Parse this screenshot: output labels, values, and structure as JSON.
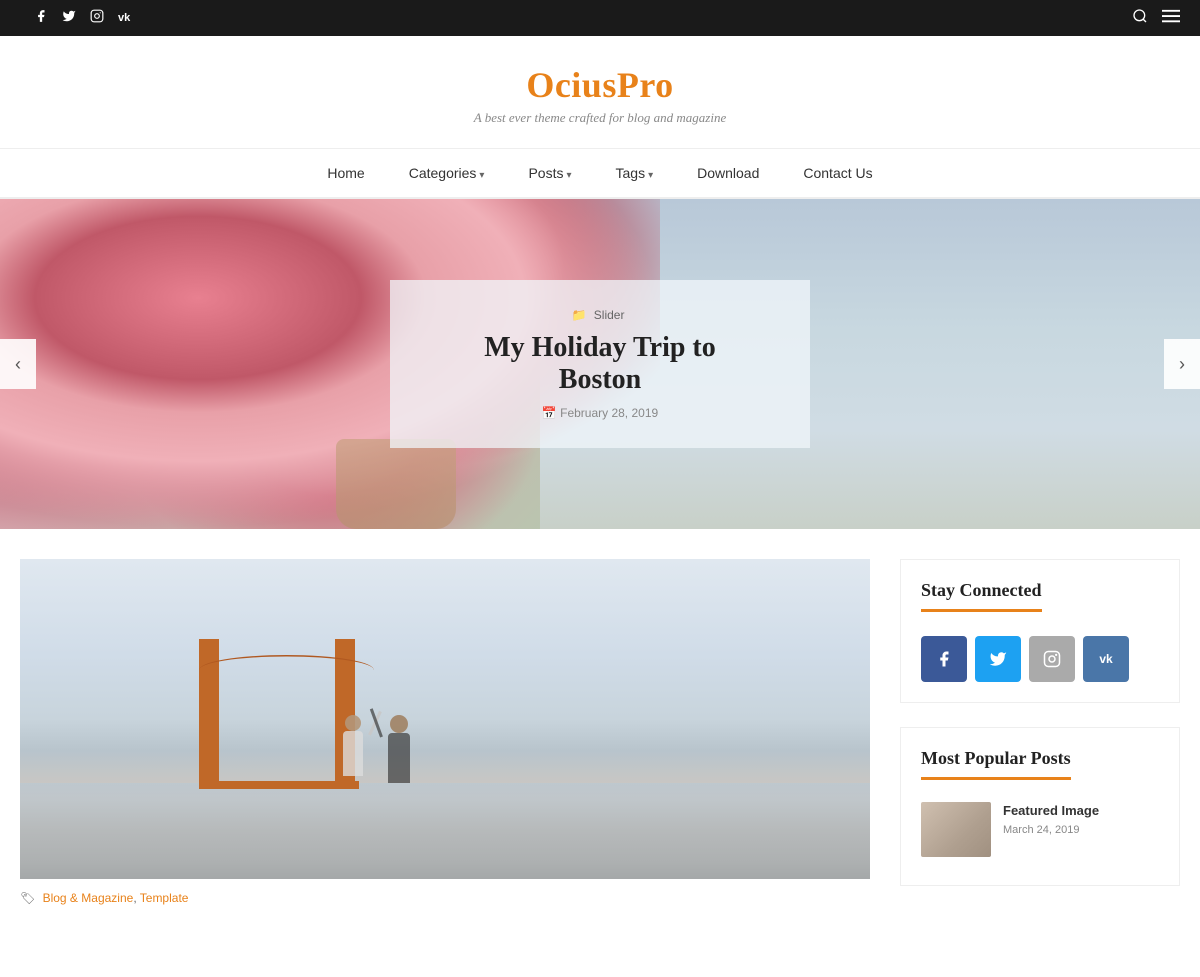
{
  "topbar": {
    "social_icons": [
      "f",
      "t",
      "i",
      "v"
    ],
    "social_names": [
      "facebook",
      "twitter",
      "instagram",
      "vk"
    ]
  },
  "header": {
    "site_title": "OciusPro",
    "tagline": "A best ever theme crafted for blog and magazine"
  },
  "nav": {
    "items": [
      {
        "label": "Home",
        "has_dropdown": false
      },
      {
        "label": "Categories",
        "has_dropdown": true
      },
      {
        "label": "Posts",
        "has_dropdown": true
      },
      {
        "label": "Tags",
        "has_dropdown": true
      },
      {
        "label": "Download",
        "has_dropdown": false
      },
      {
        "label": "Contact Us",
        "has_dropdown": false
      }
    ]
  },
  "slider": {
    "category": "Slider",
    "title": "My Holiday Trip to Boston",
    "date": "February 28, 2019",
    "prev_label": "‹",
    "next_label": "›"
  },
  "main_post": {
    "categories": "Blog & Magazine, Template",
    "image_alt": "Two people in front of Golden Gate Bridge"
  },
  "sidebar": {
    "stay_connected": {
      "title": "Stay Connected",
      "social_buttons": [
        {
          "name": "facebook",
          "icon": "f",
          "label": "Facebook"
        },
        {
          "name": "twitter",
          "icon": "t",
          "label": "Twitter"
        },
        {
          "name": "instagram",
          "icon": "i",
          "label": "Instagram"
        },
        {
          "name": "vk",
          "icon": "vk",
          "label": "VK"
        }
      ]
    },
    "popular_posts": {
      "title": "Most Popular Posts",
      "items": [
        {
          "title": "Featured Image",
          "date": "March 24, 2019"
        }
      ]
    }
  }
}
